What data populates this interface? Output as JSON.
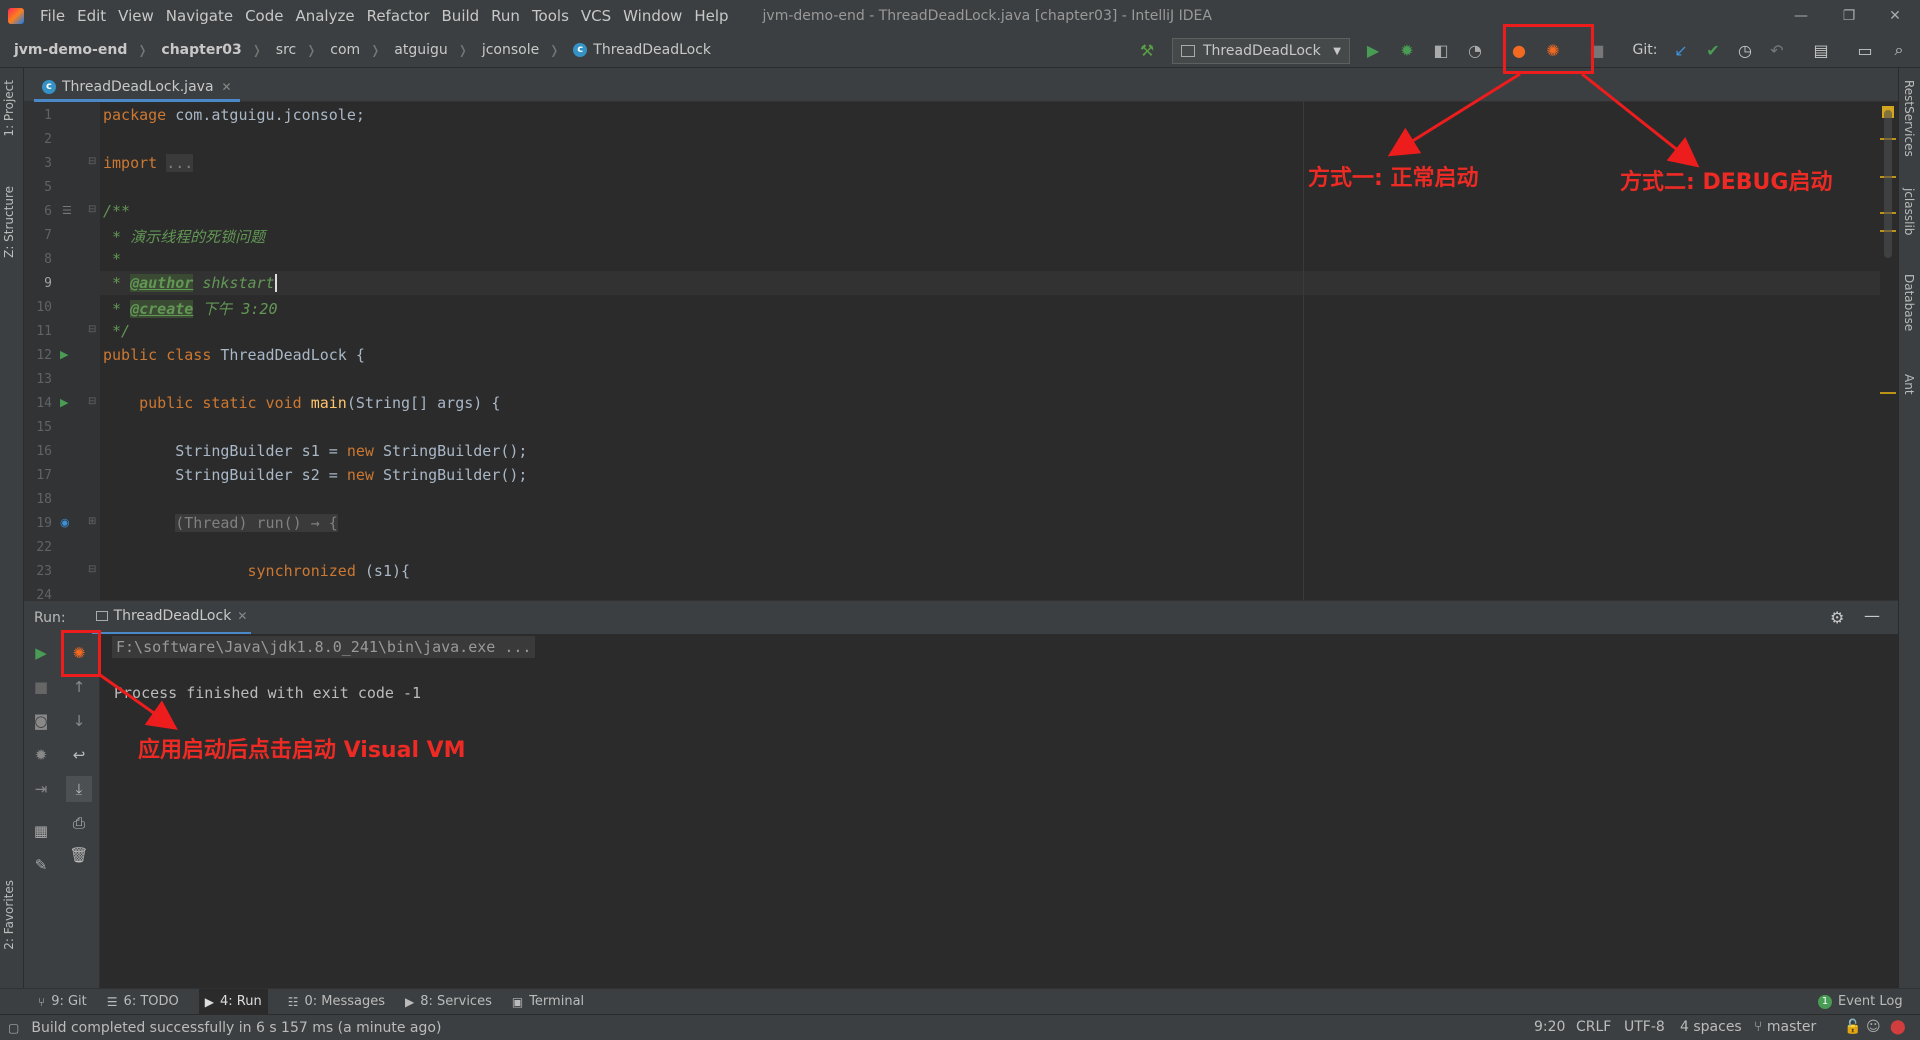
{
  "window": {
    "title": "jvm-demo-end - ThreadDeadLock.java [chapter03] - IntelliJ IDEA",
    "menu": [
      "File",
      "Edit",
      "View",
      "Navigate",
      "Code",
      "Analyze",
      "Refactor",
      "Build",
      "Run",
      "Tools",
      "VCS",
      "Window",
      "Help"
    ],
    "controls": {
      "minimize": "—",
      "restore": "❐",
      "close": "✕"
    }
  },
  "breadcrumbs": [
    "jvm-demo-end",
    "chapter03",
    "src",
    "com",
    "atguigu",
    "jconsole",
    "ThreadDeadLock"
  ],
  "toolbar": {
    "run_config": "ThreadDeadLock",
    "git_label": "Git:"
  },
  "editor": {
    "tab": "ThreadDeadLock.java",
    "line_numbers": [
      "1",
      "2",
      "3",
      "5",
      "6",
      "7",
      "8",
      "9",
      "10",
      "11",
      "12",
      "13",
      "14",
      "15",
      "16",
      "17",
      "18",
      "19",
      "22",
      "23",
      "24"
    ],
    "lines": {
      "l1_kw": "package",
      "l1_rest": " com.atguigu.jconsole;",
      "l3_kw": "import ",
      "l3_fold": "...",
      "l6": "/**",
      "l7": " * 演示线程的死锁问题",
      "l8": " *",
      "l9_pre": " * ",
      "l9_tag": "@author",
      "l9_rest": " shkstart",
      "l10_pre": " * ",
      "l10_tag": "@create",
      "l10_rest": " 下午 3:20",
      "l11": " */",
      "l12_kw": "public class ",
      "l12_rest": "ThreadDeadLock {",
      "l14_kw": "    public static void ",
      "l14_fn": "main",
      "l14_rest": "(String[] args) {",
      "l16_a": "        StringBuilder s1 = ",
      "l16_kw": "new",
      "l16_b": " StringBuilder();",
      "l17_a": "        StringBuilder s2 = ",
      "l17_kw": "new",
      "l17_b": " StringBuilder();",
      "l19_pre": "        ",
      "l19_fold": "(Thread) run() → {",
      "l23_kw": "                synchronized",
      "l23_rest": " (s1){"
    }
  },
  "run_panel": {
    "label": "Run:",
    "tab": "ThreadDeadLock",
    "console": [
      "F:\\software\\Java\\jdk1.8.0_241\\bin\\java.exe ...",
      "Process finished with exit code -1"
    ]
  },
  "side_tabs": {
    "left": [
      "1: Project",
      "Z: Structure",
      "2: Favorites"
    ],
    "right": [
      "RestServices",
      "jclasslib",
      "Database",
      "Ant"
    ]
  },
  "tool_tabs": [
    "9: Git",
    "6: TODO",
    "4: Run",
    "0: Messages",
    "8: Services",
    "Terminal"
  ],
  "event_log": {
    "count": "1",
    "label": "Event Log"
  },
  "status": {
    "message": "Build completed successfully in 6 s 157 ms (a minute ago)",
    "position": "9:20",
    "line_sep": "CRLF",
    "encoding": "UTF-8",
    "indent": "4 spaces",
    "branch": "master"
  },
  "annotations": {
    "method1": "方式一: 正常启动",
    "method2": "方式二: DEBUG启动",
    "visualvm": "应用启动后点击启动 Visual VM"
  },
  "colors": {
    "accent": "#4a88c7",
    "annotation": "#ee1d1d",
    "run_green": "#499c54",
    "keyword": "#cc7832",
    "comment": "#629755"
  }
}
